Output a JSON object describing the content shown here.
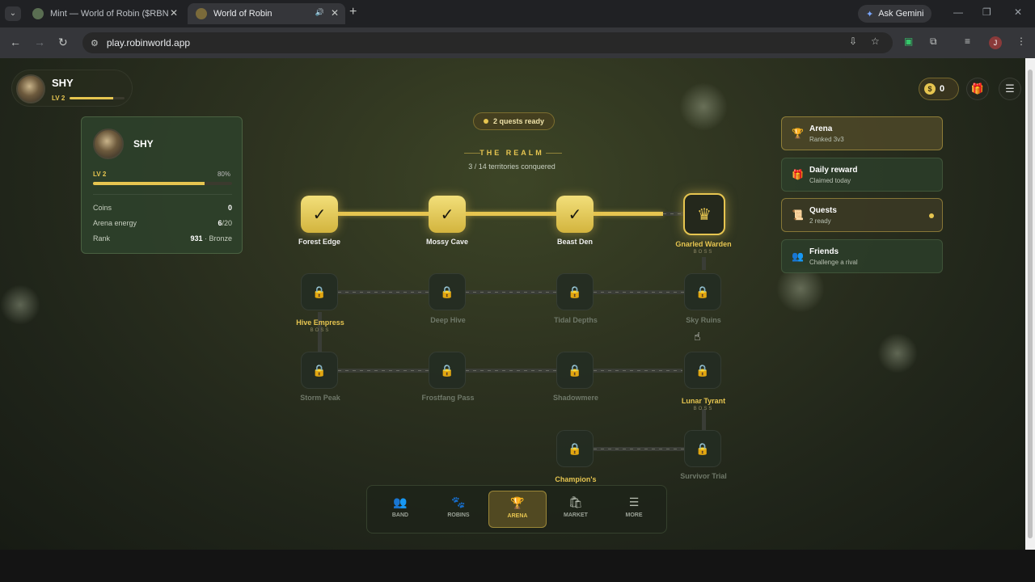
{
  "browser": {
    "tabs": [
      {
        "title": "Mint — World of Robin ($RBN",
        "close": "✕"
      },
      {
        "title": "World of Robin",
        "close": "✕",
        "audio": "🔊"
      }
    ],
    "new_tab": "+",
    "gemini": "Ask Gemini",
    "url": "play.robinworld.app",
    "profile_initial": "J"
  },
  "player": {
    "name": "SHY",
    "level": "LV 2",
    "xp_fraction": 0.8
  },
  "profile_card": {
    "name": "SHY",
    "level": "LV 2",
    "xp_percent_label": "80%",
    "stats": {
      "coins_label": "Coins",
      "coins_value": "0",
      "energy_label": "Arena energy",
      "energy_value": "6",
      "energy_max": "/20",
      "rank_label": "Rank",
      "rank_value": "931",
      "rank_tier": "· Bronze"
    }
  },
  "realm": {
    "quests_badge": "2 quests ready",
    "title": "THE REALM",
    "subtitle": "3 / 14 territories conquered",
    "boss_tag": "BOSS",
    "nodes": {
      "forest_edge": "Forest Edge",
      "mossy_cave": "Mossy Cave",
      "beast_den": "Beast Den",
      "gnarled_warden": "Gnarled Warden",
      "hive_empress": "Hive Empress",
      "deep_hive": "Deep Hive",
      "tidal_depths": "Tidal Depths",
      "sky_ruins": "Sky Ruins",
      "storm_peak": "Storm Peak",
      "frostfang_pass": "Frostfang Pass",
      "shadowmere": "Shadowmere",
      "lunar_tyrant": "Lunar Tyrant",
      "champions": "Champion's",
      "survivor_trial": "Survivor Trial"
    }
  },
  "top_right": {
    "coins": "0",
    "coin_symbol": "$"
  },
  "menu": {
    "arena": {
      "title": "Arena",
      "sub": "Ranked 3v3"
    },
    "daily": {
      "title": "Daily reward",
      "sub": "Claimed today"
    },
    "quests": {
      "title": "Quests",
      "sub": "2 ready"
    },
    "friends": {
      "title": "Friends",
      "sub": "Challenge a rival"
    }
  },
  "nav": {
    "band": "BAND",
    "robins": "ROBINS",
    "arena": "ARENA",
    "market": "MARKET",
    "more": "MORE"
  },
  "colors": {
    "accent": "#e6c550",
    "panel": "#2e422c",
    "background": "#20251a"
  },
  "icons": [
    "check-icon",
    "crown-icon",
    "lock-icon",
    "trophy-icon",
    "gift-icon",
    "scroll-icon",
    "friends-icon",
    "menu-icon",
    "coin-icon",
    "band-icon",
    "robins-icon",
    "market-icon",
    "more-icon"
  ]
}
